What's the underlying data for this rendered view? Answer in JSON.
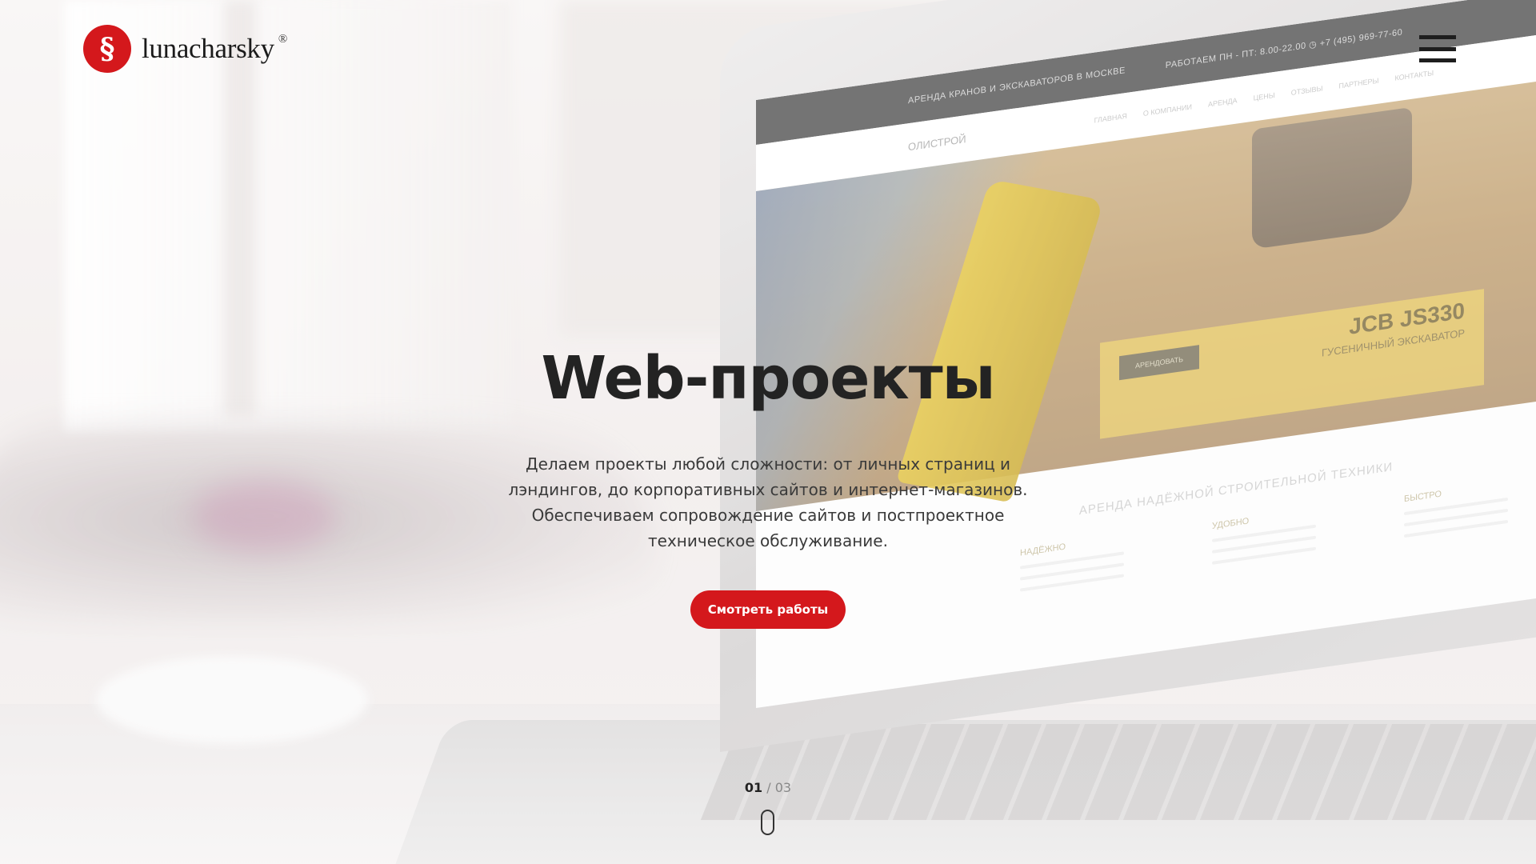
{
  "header": {
    "logo_symbol": "§",
    "logo_text": "lunacharsky",
    "logo_reg": "®",
    "menu_icon": "hamburger-icon"
  },
  "hero": {
    "title": "Web-проекты",
    "description": "Делаем проекты любой сложности: от личных страниц и лэндингов, до корпоративных сайтов и интернет-магазинов. Обеспечиваем сопровождение сайтов и постпроектное техническое обслуживание.",
    "button_label": "Смотреть работы"
  },
  "pager": {
    "current": "01",
    "separator": "/",
    "total": "03",
    "scroll_icon": "mouse-scroll-icon"
  },
  "laptop_screen": {
    "topbar_left": "АРЕНДА КРАНОВ И ЭКСКАВАТОРОВ В МОСКВЕ",
    "topbar_right": "РАБОТАЕМ ПН - ПТ: 8.00-22.00 ◷ +7 (495) 969-77-60",
    "site_logo": "ОЛИСТРОЙ",
    "nav_items": [
      "ГЛАВНАЯ",
      "О КОМПАНИИ",
      "АРЕНДА",
      "ЦЕНЫ",
      "ОТЗЫВЫ",
      "ПАРТНЕРЫ",
      "КОНТАКТЫ"
    ],
    "card_title": "JCB JS330",
    "card_subtitle": "ГУСЕНИЧНЫЙ ЭКСКАВАТОР",
    "card_button": "АРЕНДОВАТЬ",
    "section_title": "АРЕНДА НАДЁЖНОЙ СТРОИТЕЛЬНОЙ ТЕХНИКИ",
    "features": [
      "НАДЁЖНО",
      "УДОБНО",
      "БЫСТРО"
    ]
  },
  "colors": {
    "accent": "#d4181c",
    "text": "#232323"
  }
}
